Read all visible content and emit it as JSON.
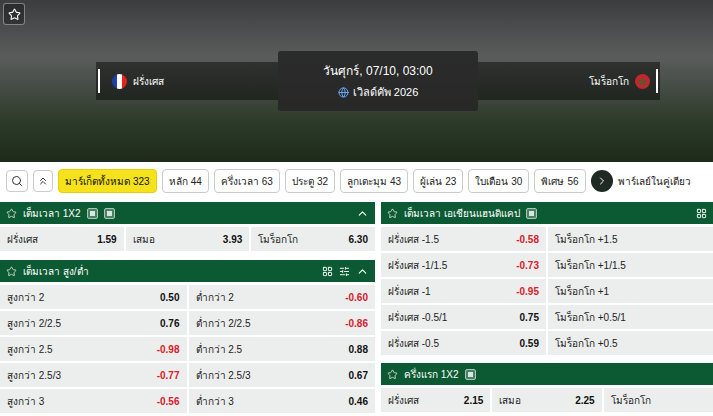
{
  "hero": {
    "home": "ฝรั่งเศส",
    "away": "โมร็อกโก",
    "datetime": "วันศุกร์, 07/10, 03:00",
    "competition": "เวิลด์คัพ 2026"
  },
  "tabs": [
    {
      "label": "มาร์เก็ตทั้งหมด",
      "count": "323",
      "selected": true
    },
    {
      "label": "หลัก",
      "count": "44",
      "selected": false
    },
    {
      "label": "ครึ่งเวลา",
      "count": "63",
      "selected": false
    },
    {
      "label": "ประตู",
      "count": "32",
      "selected": false
    },
    {
      "label": "ลูกเตะมุม",
      "count": "43",
      "selected": false
    },
    {
      "label": "ผู้เล่น",
      "count": "23",
      "selected": false
    },
    {
      "label": "ใบเตือน",
      "count": "30",
      "selected": false
    },
    {
      "label": "พิเศษ",
      "count": "56",
      "selected": false
    }
  ],
  "tabs_more": "พาร์เลย์ในคู่เดียว",
  "left_panels": [
    {
      "title": "เต็มเวลา 1X2",
      "kind": "1x2",
      "expanded": true,
      "rows": [
        [
          {
            "label": "ฝรั่งเศส",
            "odds": "1.59"
          },
          {
            "label": "เสมอ",
            "odds": "3.93"
          },
          {
            "label": "โมร็อกโก",
            "odds": "6.30"
          }
        ]
      ]
    },
    {
      "title": "เต็มเวลา สูง/ต่ำ",
      "kind": "totals",
      "expanded": true,
      "rows": [
        [
          {
            "label": "สูงกว่า 2",
            "odds": "0.50"
          },
          {
            "label": "ต่ำกว่า 2",
            "odds": "-0.60"
          }
        ],
        [
          {
            "label": "สูงกว่า 2/2.5",
            "odds": "0.76"
          },
          {
            "label": "ต่ำกว่า 2/2.5",
            "odds": "-0.86"
          }
        ],
        [
          {
            "label": "สูงกว่า 2.5",
            "odds": "-0.98"
          },
          {
            "label": "ต่ำกว่า 2.5",
            "odds": "0.88"
          }
        ],
        [
          {
            "label": "สูงกว่า 2.5/3",
            "odds": "-0.77"
          },
          {
            "label": "ต่ำกว่า 2.5/3",
            "odds": "0.67"
          }
        ],
        [
          {
            "label": "สูงกว่า 3",
            "odds": "-0.56"
          },
          {
            "label": "ต่ำกว่า 3",
            "odds": "0.46"
          }
        ]
      ]
    }
  ],
  "right_panels": [
    {
      "title": "เต็มเวลา เอเชียนแฮนดิแคป",
      "kind": "handicap",
      "expanded": true,
      "rows": [
        [
          {
            "label": "ฝรั่งเศส -1.5",
            "odds": "-0.58"
          },
          {
            "label": "โมร็อกโก +1.5",
            "odds": null
          }
        ],
        [
          {
            "label": "ฝรั่งเศส -1/1.5",
            "odds": "-0.73"
          },
          {
            "label": "โมร็อกโก +1/1.5",
            "odds": null
          }
        ],
        [
          {
            "label": "ฝรั่งเศส -1",
            "odds": "-0.95"
          },
          {
            "label": "โมร็อกโก +1",
            "odds": null
          }
        ],
        [
          {
            "label": "ฝรั่งเศส -0.5/1",
            "odds": "0.75"
          },
          {
            "label": "โมร็อกโก +0.5/1",
            "odds": null
          }
        ],
        [
          {
            "label": "ฝรั่งเศส -0.5",
            "odds": "0.59"
          },
          {
            "label": "โมร็อกโก +0.5",
            "odds": null
          }
        ]
      ]
    },
    {
      "title": "ครึ่งแรก 1X2",
      "kind": "half",
      "expanded": true,
      "rows": [
        [
          {
            "label": "ฝรั่งเศส",
            "odds": "2.15"
          },
          {
            "label": "เสมอ",
            "odds": "2.25"
          },
          {
            "label": "โมร็อกโก",
            "odds": null
          }
        ]
      ]
    }
  ]
}
